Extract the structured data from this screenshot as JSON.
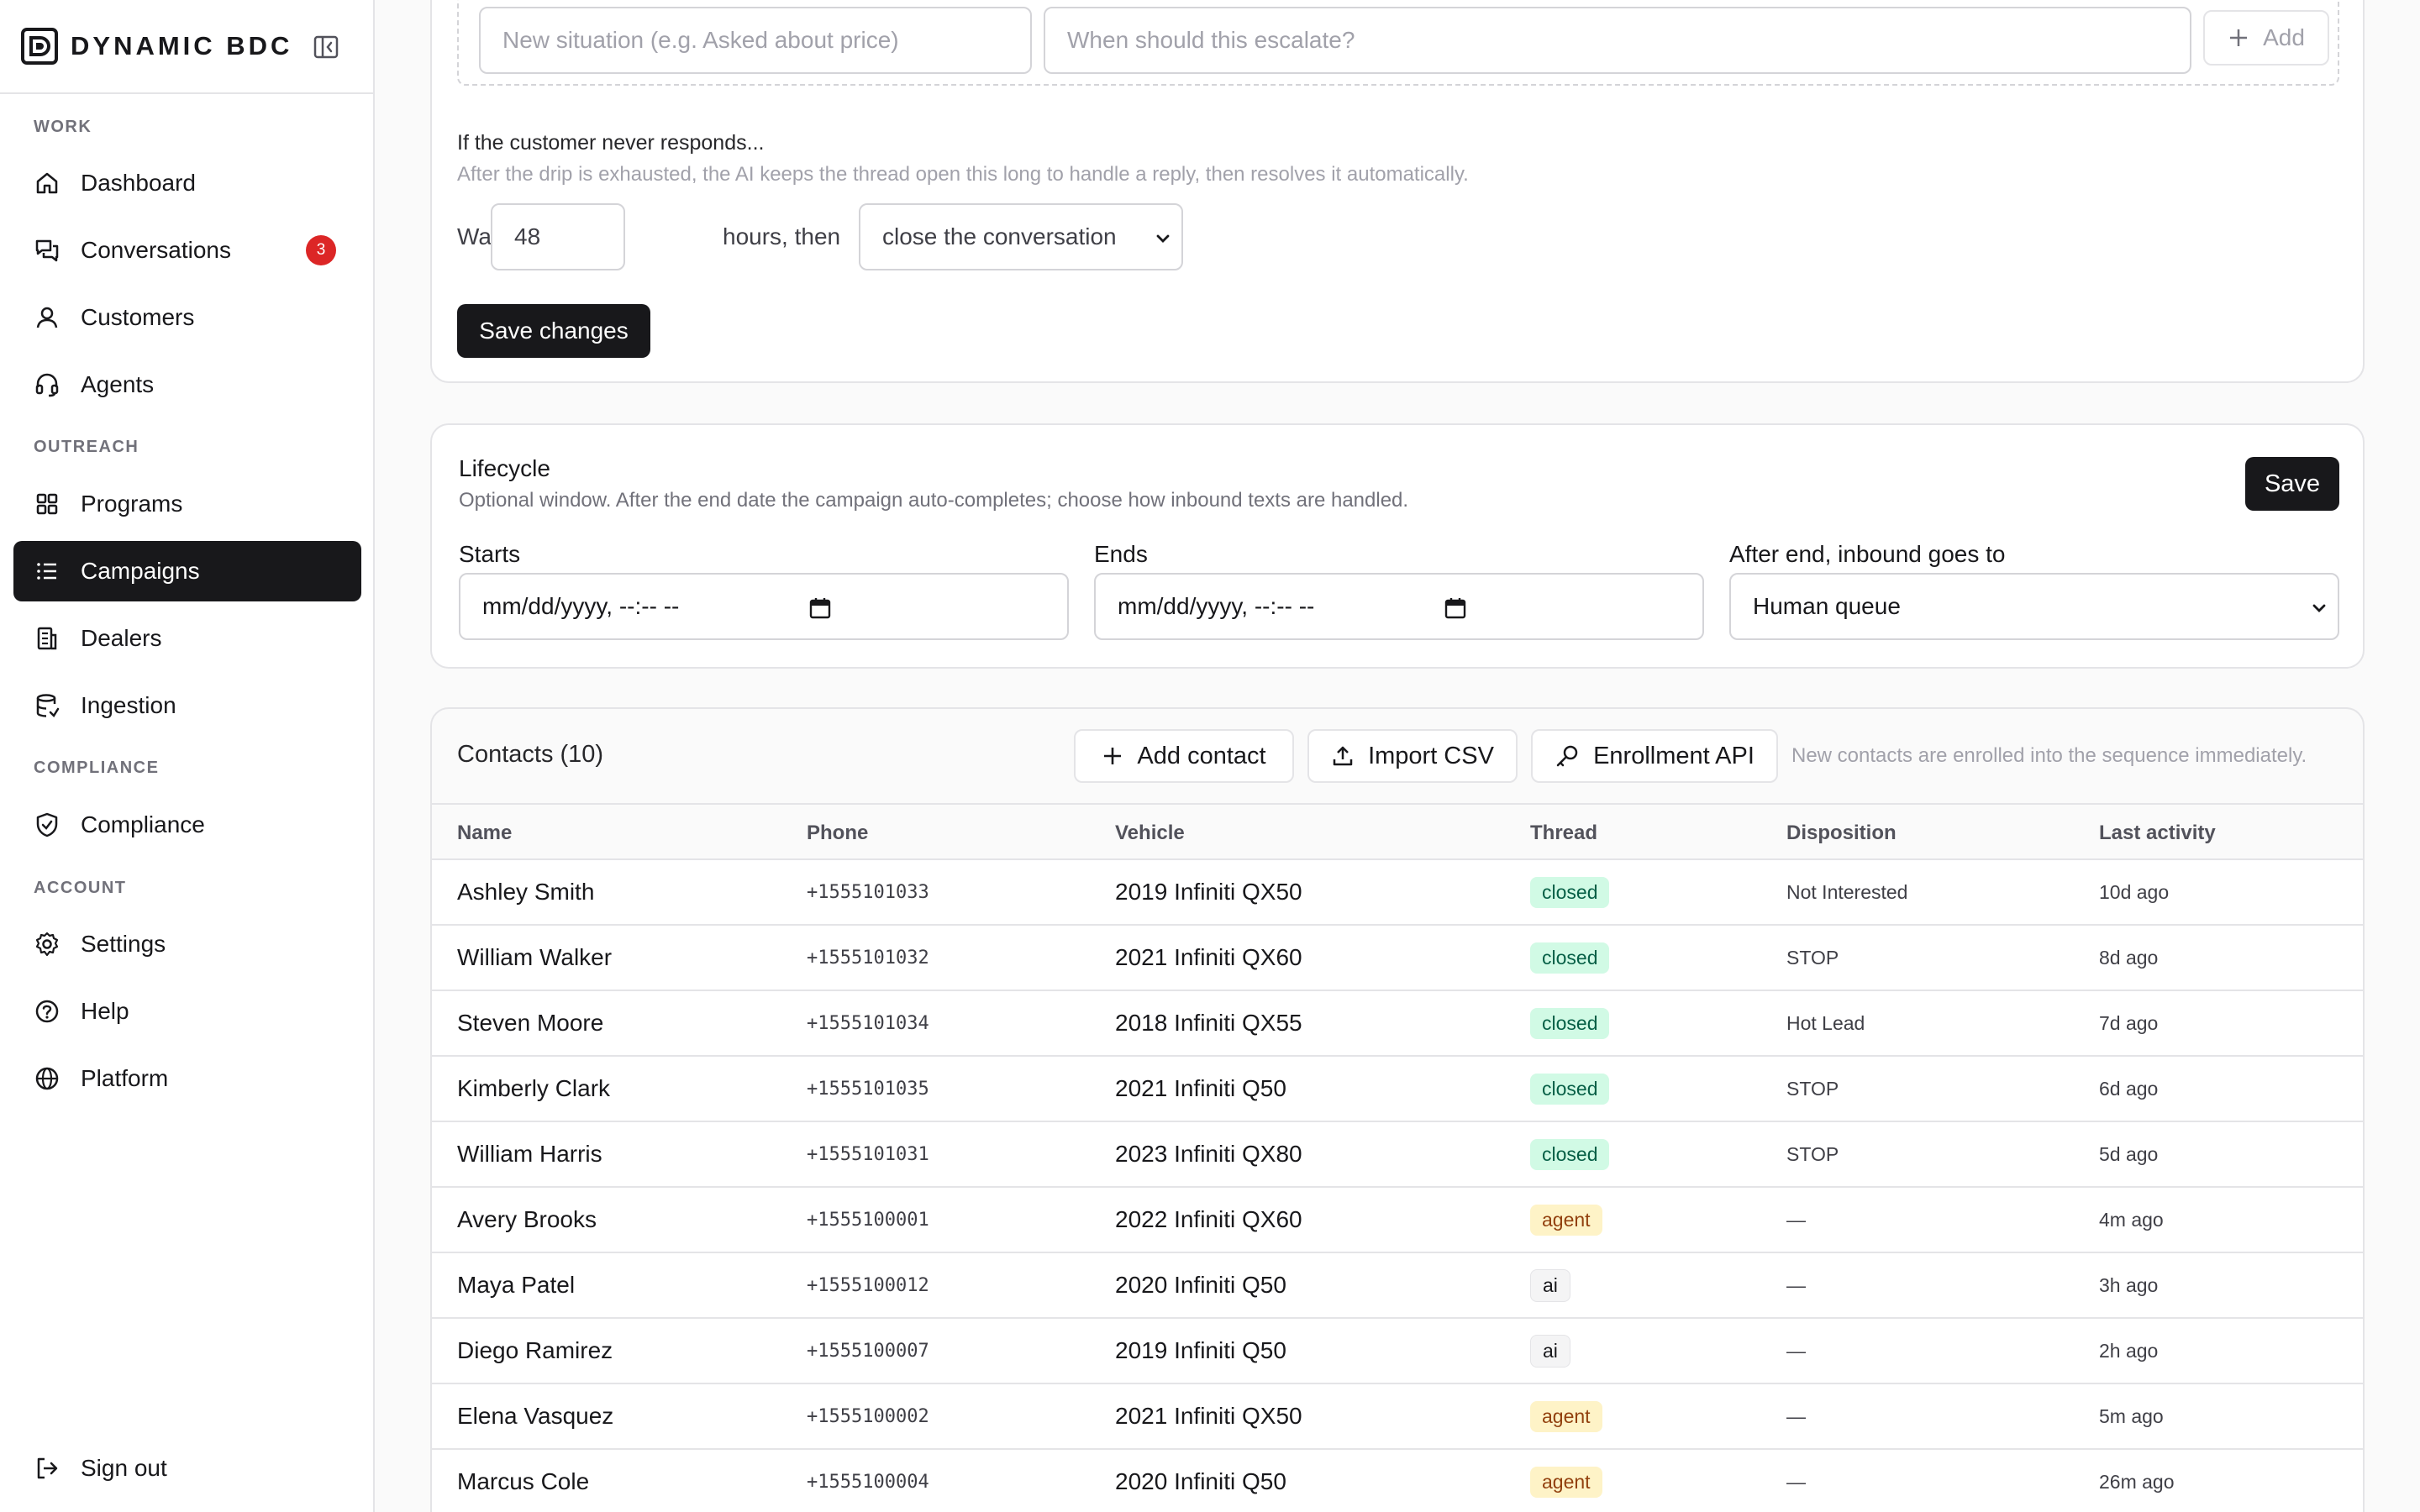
{
  "brand": {
    "name": "DYNAMIC BDC"
  },
  "sidebar": {
    "sections": [
      {
        "label": "WORK"
      },
      {
        "label": "OUTREACH"
      },
      {
        "label": "COMPLIANCE"
      },
      {
        "label": "ACCOUNT"
      }
    ],
    "items": [
      {
        "label": "Dashboard",
        "icon": "home-icon"
      },
      {
        "label": "Conversations",
        "icon": "chat-icon",
        "badge": "3"
      },
      {
        "label": "Customers",
        "icon": "user-icon"
      },
      {
        "label": "Agents",
        "icon": "headset-icon"
      },
      {
        "label": "Programs",
        "icon": "grid-icon"
      },
      {
        "label": "Campaigns",
        "icon": "list-icon",
        "active": true
      },
      {
        "label": "Dealers",
        "icon": "building-icon"
      },
      {
        "label": "Ingestion",
        "icon": "database-icon"
      },
      {
        "label": "Compliance",
        "icon": "shield-icon"
      },
      {
        "label": "Settings",
        "icon": "gear-icon"
      },
      {
        "label": "Help",
        "icon": "help-circle-icon"
      },
      {
        "label": "Platform",
        "icon": "globe-icon"
      }
    ],
    "signout": {
      "label": "Sign out",
      "icon": "logout-icon"
    }
  },
  "escalation": {
    "situation_placeholder": "New situation (e.g. Asked about price)",
    "when_placeholder": "When should this escalate?",
    "add_label": "Add"
  },
  "no_response": {
    "title": "If the customer never responds...",
    "description": "After the drip is exhausted, the AI keeps the thread open this long to handle a reply, then resolves it automatically.",
    "wait_label": "Wait",
    "hours_value": "48",
    "hours_then_label": "hours, then",
    "action_selected": "close the conversation",
    "save_label": "Save changes"
  },
  "lifecycle": {
    "title": "Lifecycle",
    "description": "Optional window. After the end date the campaign auto-completes; choose how inbound texts are handled.",
    "save_label": "Save",
    "starts_label": "Starts",
    "starts_value": "mm/dd/yyyy, --:-- --",
    "ends_label": "Ends",
    "ends_value": "mm/dd/yyyy, --:-- --",
    "after_end_label": "After end, inbound goes to",
    "after_end_selected": "Human queue"
  },
  "contacts": {
    "title": "Contacts (10)",
    "add_contact_label": "Add contact",
    "import_csv_label": "Import CSV",
    "enrollment_api_label": "Enrollment API",
    "note": "New contacts are enrolled into the sequence immediately.",
    "columns": [
      "Name",
      "Phone",
      "Vehicle",
      "Thread",
      "Disposition",
      "Last activity"
    ],
    "rows": [
      {
        "name": "Ashley Smith",
        "phone": "+1555101033",
        "vehicle": "2019 Infiniti QX50",
        "thread": "closed",
        "disposition": "Not Interested",
        "last": "10d ago"
      },
      {
        "name": "William Walker",
        "phone": "+1555101032",
        "vehicle": "2021 Infiniti QX60",
        "thread": "closed",
        "disposition": "STOP",
        "last": "8d ago"
      },
      {
        "name": "Steven Moore",
        "phone": "+1555101034",
        "vehicle": "2018 Infiniti QX55",
        "thread": "closed",
        "disposition": "Hot Lead",
        "last": "7d ago"
      },
      {
        "name": "Kimberly Clark",
        "phone": "+1555101035",
        "vehicle": "2021 Infiniti Q50",
        "thread": "closed",
        "disposition": "STOP",
        "last": "6d ago"
      },
      {
        "name": "William Harris",
        "phone": "+1555101031",
        "vehicle": "2023 Infiniti QX80",
        "thread": "closed",
        "disposition": "STOP",
        "last": "5d ago"
      },
      {
        "name": "Avery Brooks",
        "phone": "+1555100001",
        "vehicle": "2022 Infiniti QX60",
        "thread": "agent",
        "disposition": "—",
        "last": "4m ago"
      },
      {
        "name": "Maya Patel",
        "phone": "+1555100012",
        "vehicle": "2020 Infiniti Q50",
        "thread": "ai",
        "disposition": "—",
        "last": "3h ago"
      },
      {
        "name": "Diego Ramirez",
        "phone": "+1555100007",
        "vehicle": "2019 Infiniti Q50",
        "thread": "ai",
        "disposition": "—",
        "last": "2h ago"
      },
      {
        "name": "Elena Vasquez",
        "phone": "+1555100002",
        "vehicle": "2021 Infiniti QX50",
        "thread": "agent",
        "disposition": "—",
        "last": "5m ago"
      },
      {
        "name": "Marcus Cole",
        "phone": "+1555100004",
        "vehicle": "2020 Infiniti Q50",
        "thread": "agent",
        "disposition": "—",
        "last": "26m ago"
      }
    ]
  },
  "colors": {
    "accent": "#18181b",
    "badge_red": "#dc2626",
    "closed_bg": "#d1fae5",
    "agent_bg": "#fef3c7",
    "ai_bg": "#f4f4f5"
  }
}
